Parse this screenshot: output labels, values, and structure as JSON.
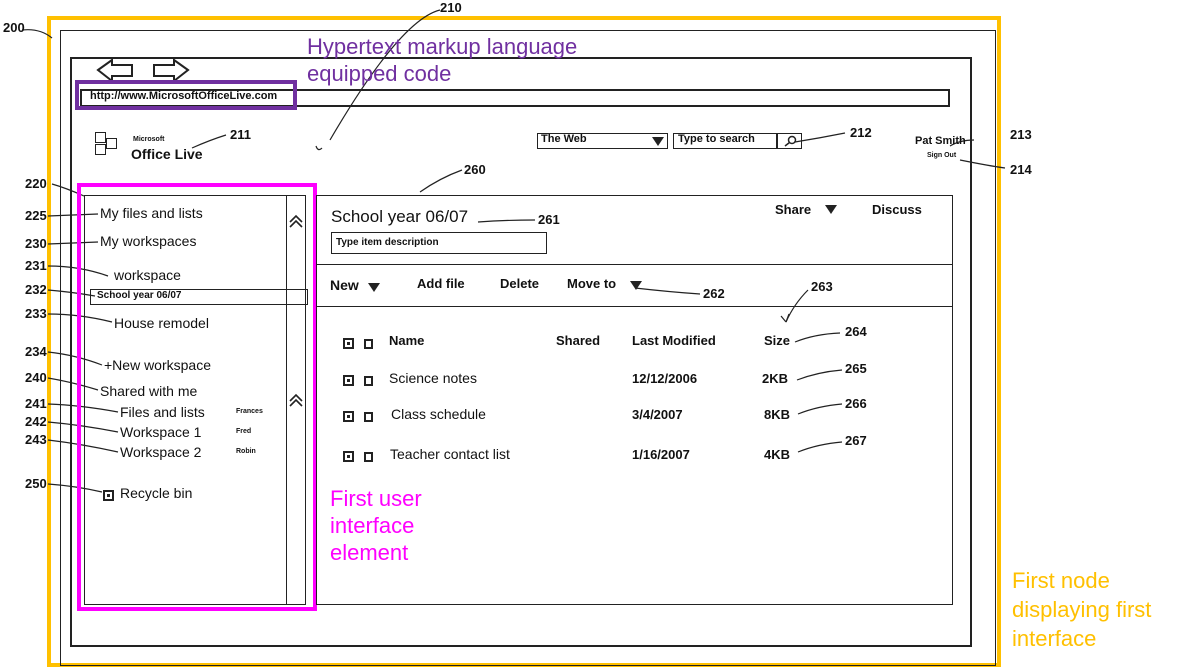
{
  "refs": {
    "r200": "200",
    "r210": "210",
    "r211": "211",
    "r212": "212",
    "r213": "213",
    "r214": "214",
    "r220": "220",
    "r225": "225",
    "r230": "230",
    "r231": "231",
    "r232": "232",
    "r233": "233",
    "r234": "234",
    "r240": "240",
    "r241": "241",
    "r242": "242",
    "r243": "243",
    "r250": "250",
    "r260": "260",
    "r261": "261",
    "r262": "262",
    "r263": "263",
    "r264": "264",
    "r265": "265",
    "r266": "266",
    "r267": "267"
  },
  "annotations": {
    "html_code": "Hypertext markup language equipped code",
    "first_ui_element": "First user interface element",
    "first_node": "First node displaying first interface"
  },
  "browser": {
    "url": "http://www.MicrosoftOfficeLive.com"
  },
  "header": {
    "logo_small": "Microsoft",
    "logo_main": "Office Live",
    "search_scope": "The Web",
    "search_placeholder": "Type to search",
    "user_name": "Pat Smith",
    "sign_out": "Sign Out"
  },
  "sidebar": {
    "my_files": "My files and lists",
    "my_workspaces": "My workspaces",
    "workspace": "workspace",
    "selected": "School year 06/07",
    "house_remodel": "House remodel",
    "new_workspace": "+New workspace",
    "shared_with_me": "Shared with me",
    "shared": [
      {
        "label": "Files and lists",
        "owner": "Frances"
      },
      {
        "label": "Workspace 1",
        "owner": "Fred"
      },
      {
        "label": "Workspace 2",
        "owner": "Robin"
      }
    ],
    "recycle_bin": "Recycle bin"
  },
  "main": {
    "title": "School year 06/07",
    "share": "Share",
    "discuss": "Discuss",
    "description_placeholder": "Type item description",
    "toolbar": {
      "new": "New",
      "add_file": "Add file",
      "delete": "Delete",
      "move_to": "Move to"
    },
    "columns": {
      "name": "Name",
      "shared": "Shared",
      "modified": "Last Modified",
      "size": "Size"
    },
    "rows": [
      {
        "name": "Science notes",
        "modified": "12/12/2006",
        "size": "2KB"
      },
      {
        "name": "Class schedule",
        "modified": "3/4/2007",
        "size": "8KB"
      },
      {
        "name": "Teacher contact list",
        "modified": "1/16/2007",
        "size": "4KB"
      }
    ]
  },
  "colors": {
    "node": "#ffc000",
    "code": "#7030a0",
    "ui_element": "#ff00ff"
  }
}
